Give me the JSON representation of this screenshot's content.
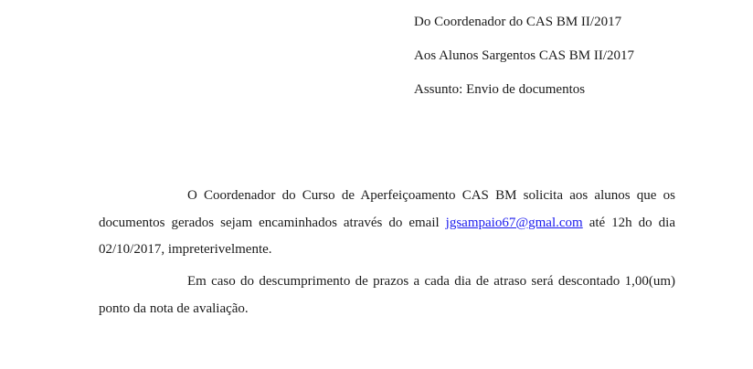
{
  "header": {
    "from": "Do Coordenador do CAS BM II/2017",
    "to": "Aos Alunos Sargentos CAS BM II/2017",
    "subject": "Assunto: Envio de documentos"
  },
  "body": {
    "paragraph1": {
      "before_link": "O Coordenador do Curso de Aperfeiçoamento CAS BM solicita aos alunos que os documentos gerados sejam encaminhados através do email ",
      "email": "jgsampaio67@gmal.com",
      "after_link": " até 12h do dia 02/10/2017, impreterivelmente."
    },
    "paragraph2": "Em caso do descumprimento de prazos a cada dia de atraso será descontado 1,00(um) ponto da nota de avaliação."
  }
}
